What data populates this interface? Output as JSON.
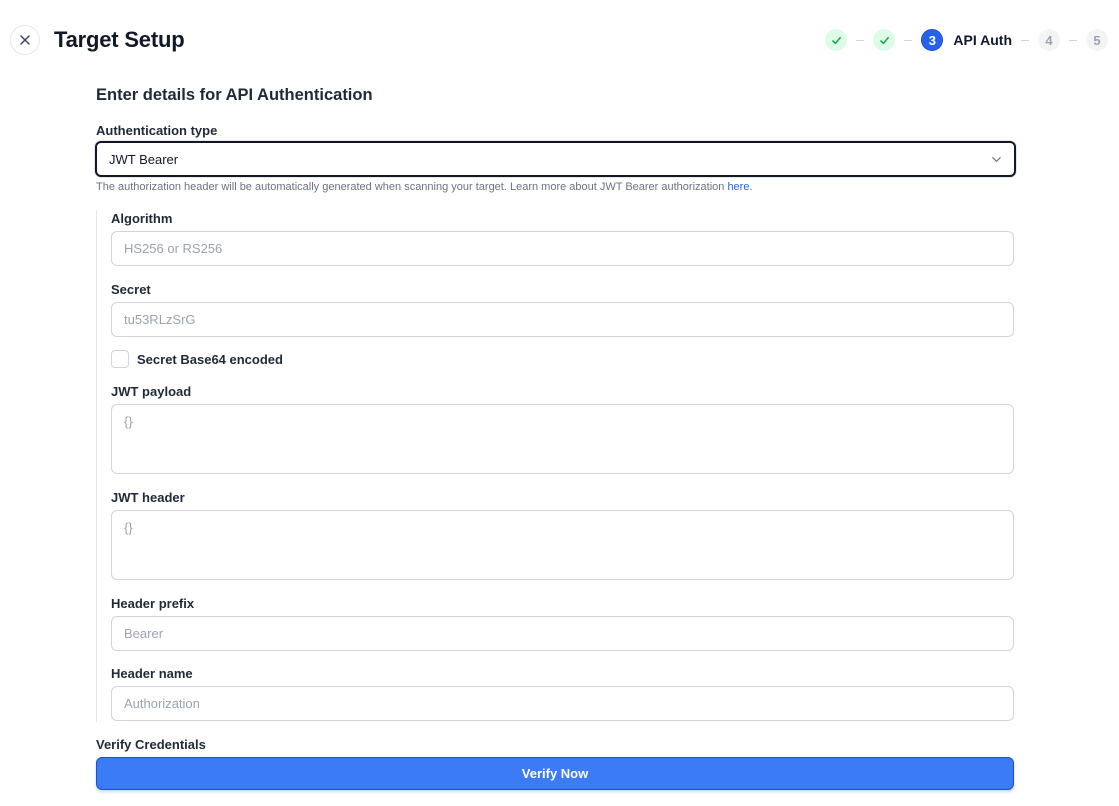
{
  "header": {
    "title": "Target Setup",
    "close_icon": "close-icon"
  },
  "stepper": {
    "steps": [
      {
        "state": "done",
        "icon": "check-icon"
      },
      {
        "state": "done",
        "icon": "check-icon"
      },
      {
        "state": "active",
        "number": "3",
        "label": "API Auth"
      },
      {
        "state": "pending",
        "number": "4"
      },
      {
        "state": "pending",
        "number": "5"
      }
    ]
  },
  "form": {
    "section_title": "Enter details for API Authentication",
    "auth_type": {
      "label": "Authentication type",
      "value": "JWT Bearer",
      "icon": "chevron-down-icon"
    },
    "helper": {
      "text": "The authorization header will be automatically generated when scanning your target. Learn more about JWT Bearer authorization ",
      "link": "here."
    },
    "algorithm": {
      "label": "Algorithm",
      "placeholder": "HS256 or RS256",
      "value": ""
    },
    "secret": {
      "label": "Secret",
      "placeholder": "tu53RLzSrG",
      "value": ""
    },
    "secret_base64": {
      "label": "Secret Base64 encoded",
      "checked": false
    },
    "jwt_payload": {
      "label": "JWT payload",
      "placeholder": "{}",
      "value": ""
    },
    "jwt_header": {
      "label": "JWT header",
      "placeholder": "{}",
      "value": ""
    },
    "header_prefix": {
      "label": "Header prefix",
      "placeholder": "Bearer",
      "value": ""
    },
    "header_name": {
      "label": "Header name",
      "placeholder": "Authorization",
      "value": ""
    },
    "verify": {
      "label": "Verify Credentials",
      "button": "Verify Now"
    }
  },
  "colors": {
    "primary": "#3b7bf6",
    "active_step": "#2563eb",
    "done_step_bg": "#dcfce7",
    "done_check": "#16a34a",
    "link": "#2563eb"
  }
}
